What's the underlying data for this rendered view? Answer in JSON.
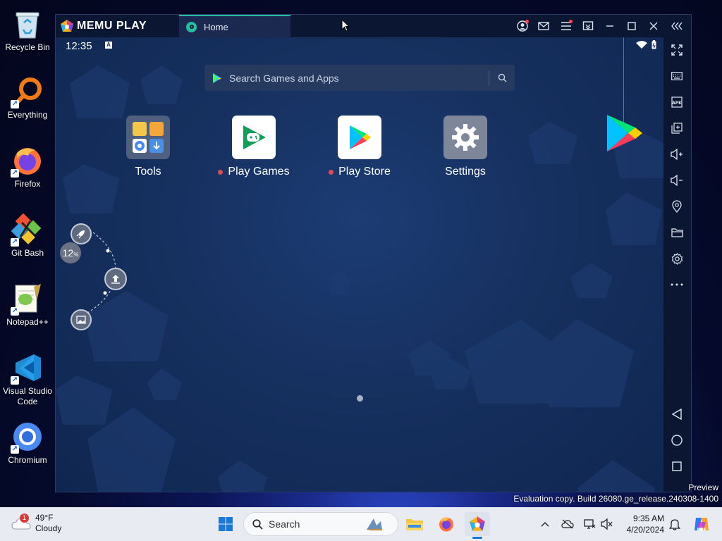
{
  "desktop": {
    "icons": [
      {
        "label": "Recycle Bin"
      },
      {
        "label": "Everything"
      },
      {
        "label": "Firefox"
      },
      {
        "label": "Git Bash"
      },
      {
        "label": "Notepad++"
      },
      {
        "label": "Visual Studio Code"
      },
      {
        "label": "Chromium"
      }
    ]
  },
  "memu": {
    "logo_text": "MEMU PLAY",
    "tab": {
      "label": "Home"
    },
    "status": {
      "time": "12:35",
      "badge": "A"
    },
    "search": {
      "placeholder": "Search Games and Apps"
    },
    "apps": [
      {
        "label": "Tools"
      },
      {
        "label": "Play Games"
      },
      {
        "label": "Play Store"
      },
      {
        "label": "Settings"
      }
    ],
    "floating": {
      "percent": "12",
      "percent_sign": "%"
    },
    "accent_color": "#21c1a1"
  },
  "watermark": {
    "line1": "Preview",
    "line2": "Evaluation copy. Build 26080.ge_release.240308-1400"
  },
  "taskbar": {
    "weather": {
      "temp": "49°F",
      "condition": "Cloudy",
      "badge": "1"
    },
    "search_label": "Search",
    "time": "9:35 AM",
    "date": "4/20/2024"
  }
}
